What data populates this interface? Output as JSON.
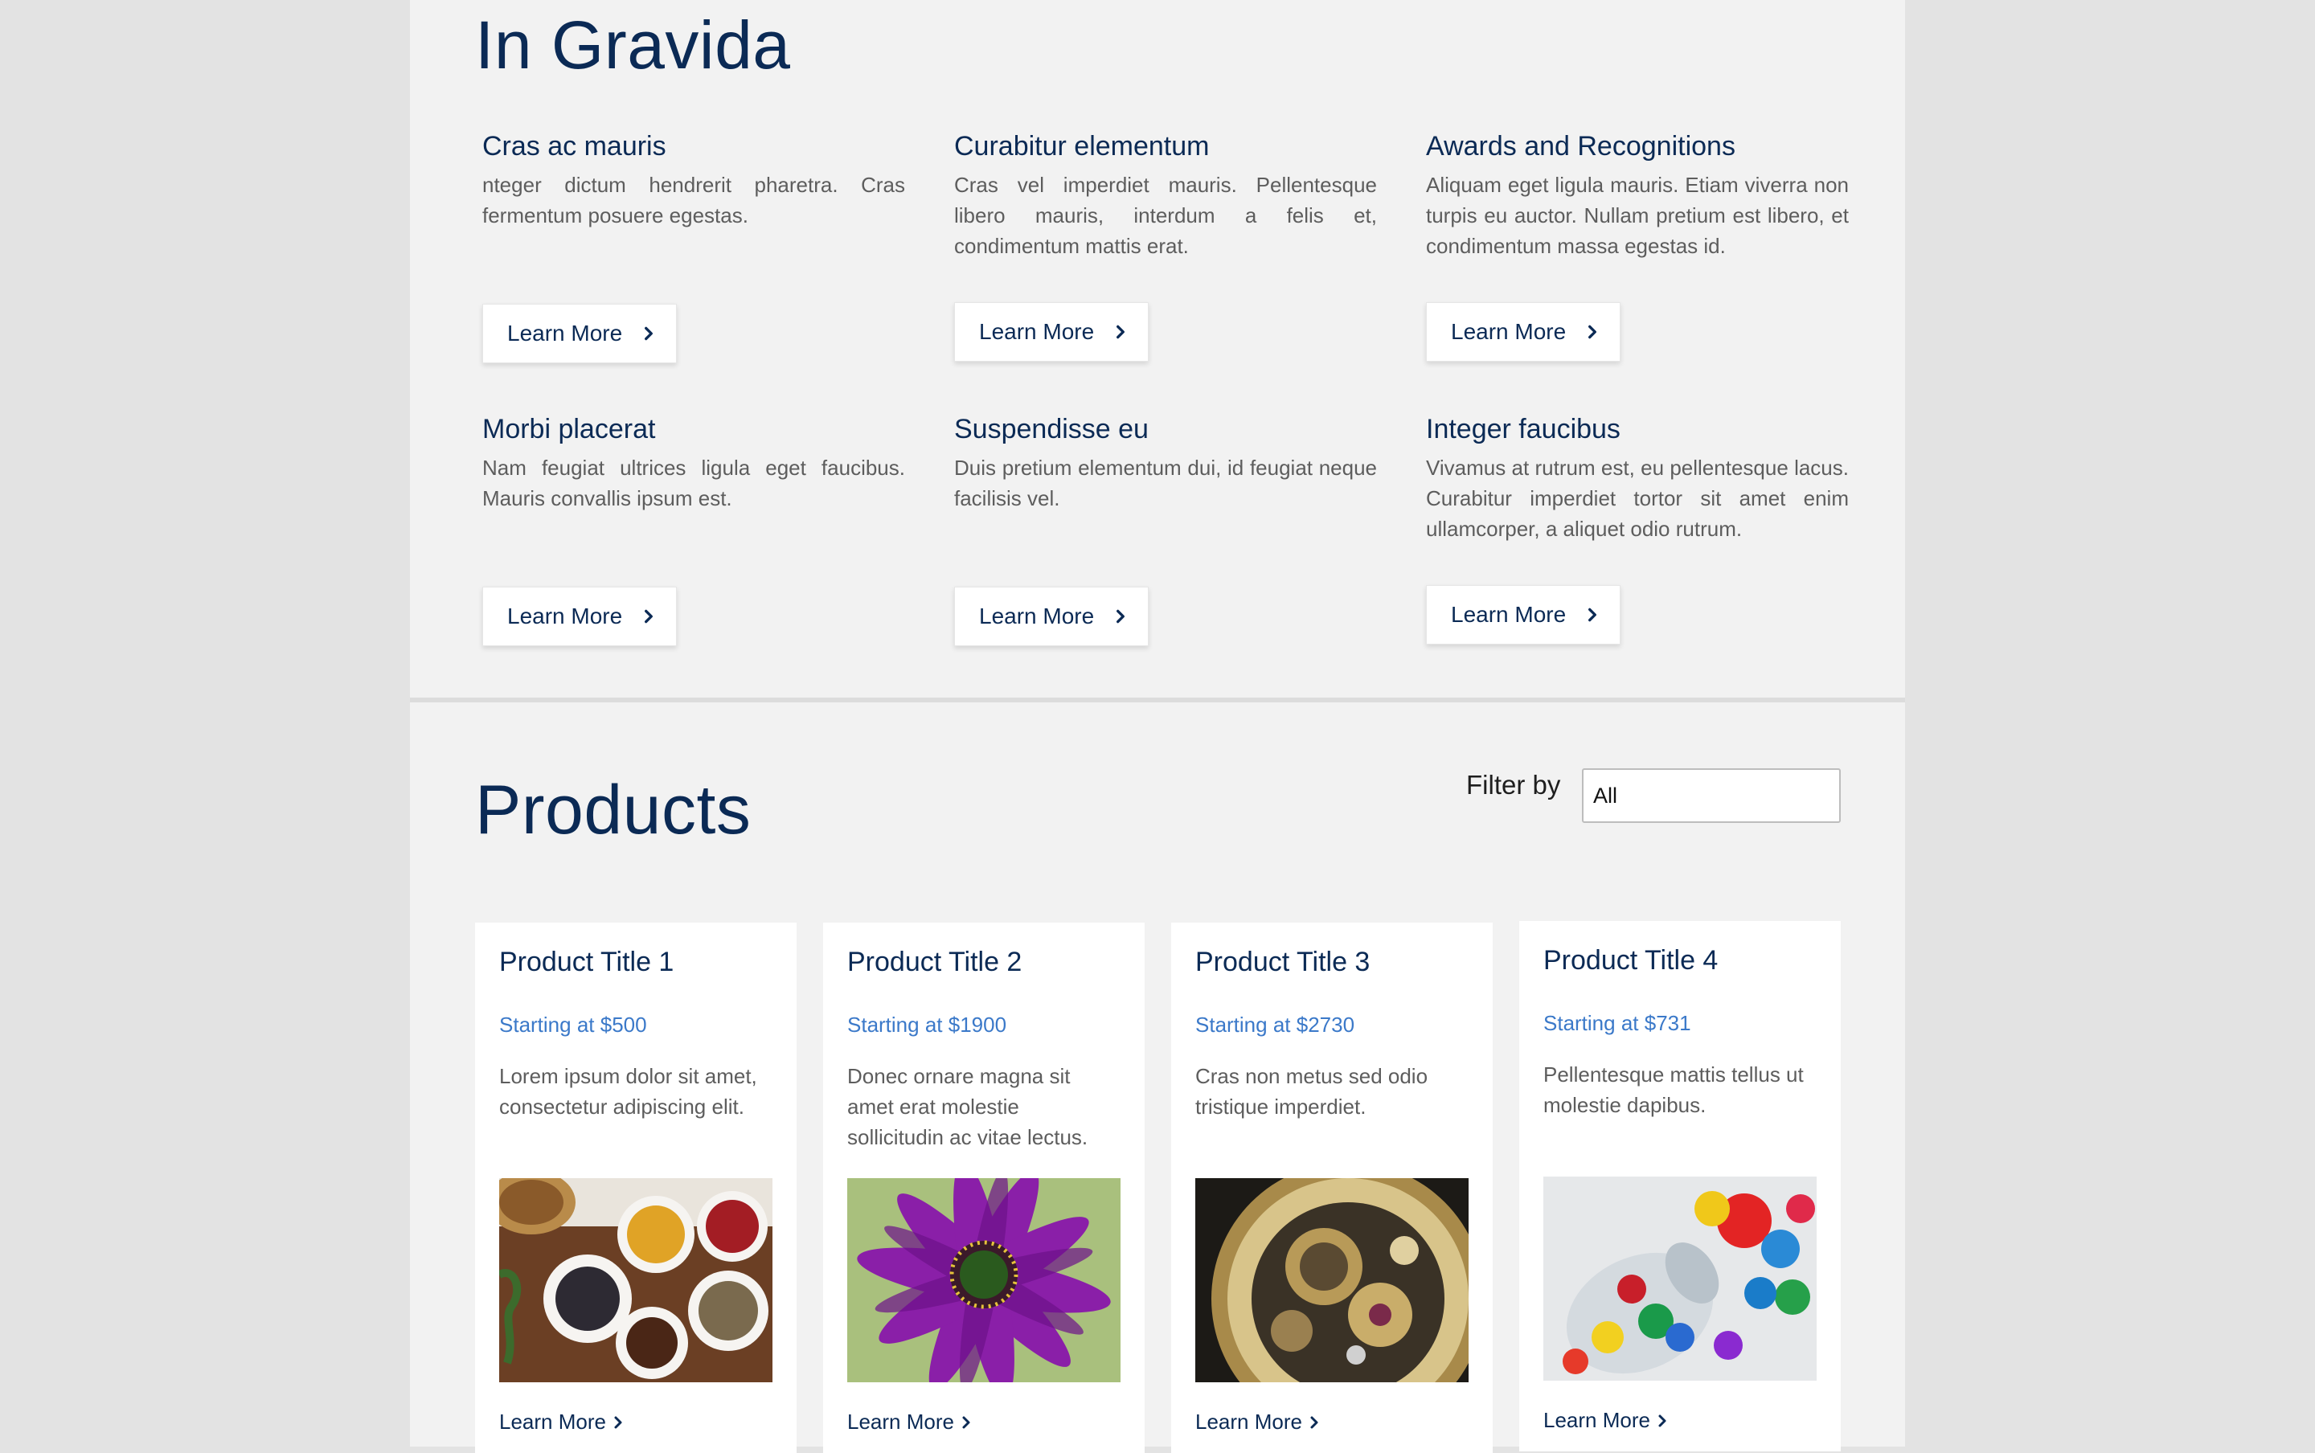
{
  "gravida": {
    "title": "In Gravida",
    "features": [
      {
        "title": "Cras ac mauris",
        "text": "nteger dictum hendrerit pharetra. Cras fermentum posuere egestas.",
        "button": "Learn More"
      },
      {
        "title": "Curabitur elementum",
        "text": "Cras vel imperdiet mauris. Pellentesque libero mauris, interdum a felis et, condimentum mattis erat.",
        "button": "Learn More"
      },
      {
        "title": "Awards and Recognitions",
        "text": "Aliquam eget ligula mauris. Etiam viverra non turpis eu auctor. Nullam pretium est libero, et condimentum massa egestas id.",
        "button": "Learn More"
      },
      {
        "title": "Morbi placerat",
        "text": "Nam feugiat ultrices ligula eget faucibus. Mauris convallis ipsum est.",
        "button": "Learn More"
      },
      {
        "title": "Suspendisse eu",
        "text": "Duis pretium elementum dui, id feugiat neque facilisis vel.",
        "button": "Learn More"
      },
      {
        "title": "Integer faucibus",
        "text": "Vivamus at rutrum est, eu pellentesque lacus. Curabitur imperdiet tortor sit amet enim ullamcorper, a aliquet odio rutrum.",
        "button": "Learn More"
      }
    ]
  },
  "products": {
    "title": "Products",
    "filter": {
      "label": "Filter by",
      "selected": "All"
    },
    "items": [
      {
        "title": "Product Title 1",
        "price": "Starting at $500",
        "desc": "Lorem ipsum dolor sit amet, consectetur adipiscing elit.",
        "link": "Learn More",
        "image": "spices-photo"
      },
      {
        "title": "Product Title 2",
        "price": "Starting at $1900",
        "desc": "Donec ornare magna sit amet erat molestie sollicitudin ac vitae lectus.",
        "link": "Learn More",
        "image": "purple-flower-photo"
      },
      {
        "title": "Product Title 3",
        "price": "Starting at $2730",
        "desc": "Cras non metus sed odio tristique imperdiet.",
        "link": "Learn More",
        "image": "watch-mechanism-photo"
      },
      {
        "title": "Product Title 4",
        "price": "Starting at $731",
        "desc": "Pellentesque mattis tellus ut molestie dapibus.",
        "link": "Learn More",
        "image": "marbles-jar-photo"
      }
    ]
  },
  "colors": {
    "heading": "#0b2a55",
    "body_text": "#5d5d5d",
    "price": "#3b79c9",
    "panel_bg": "#f2f2f2",
    "page_bg": "#e3e3e3"
  }
}
